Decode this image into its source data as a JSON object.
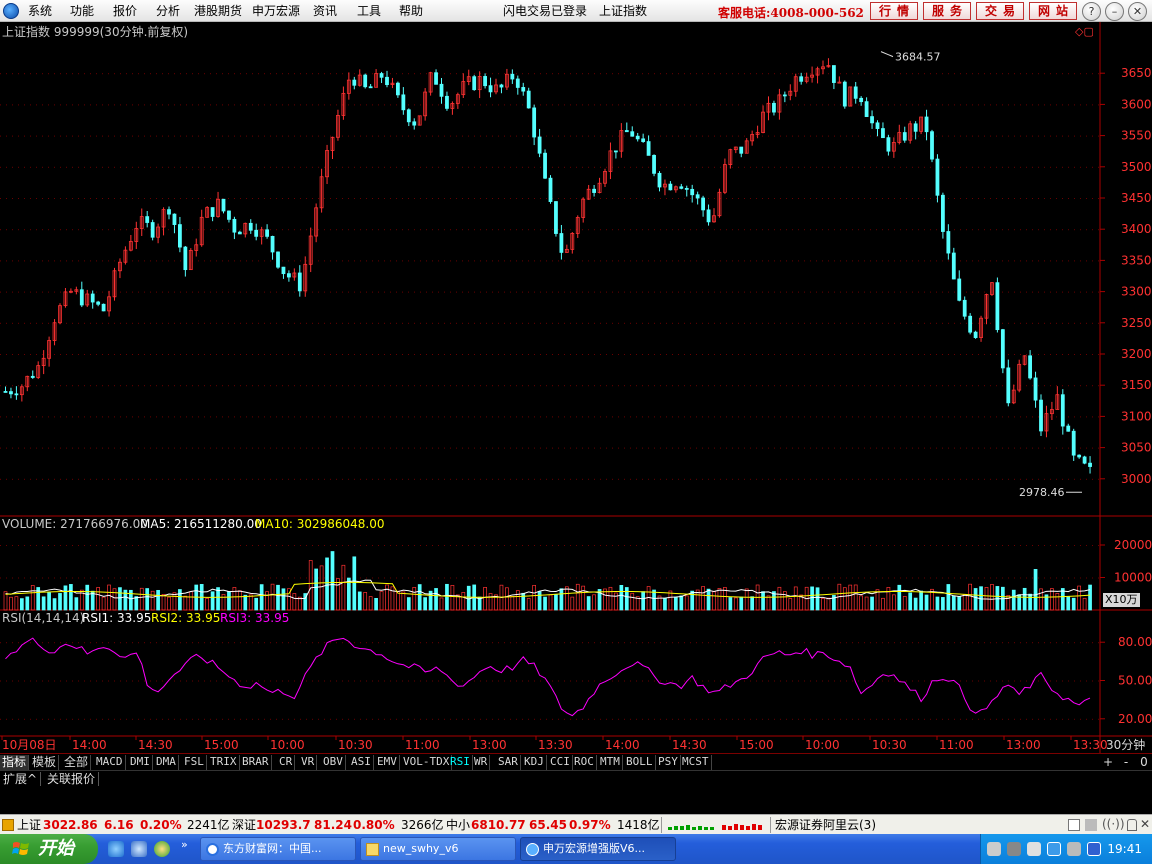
{
  "menubar": {
    "items": [
      "系统",
      "功能",
      "报价",
      "分析",
      "港股期货",
      "申万宏源",
      "资讯",
      "工具",
      "帮助"
    ],
    "login_status": "闪电交易已登录",
    "current_index": "上证指数",
    "hotline": "客服电话:4008-000-562",
    "buttons": [
      "行情",
      "服务",
      "交易",
      "网站"
    ]
  },
  "chart_header": {
    "title": "上证指数 999999(30分钟.前复权)",
    "volume_label": "VOLUME: 271766976.00",
    "ma5_label": "MA5: 216511280.00",
    "ma10_label": "MA10: 302986048.00",
    "rsi_label": "RSI(14,14,14)",
    "rsi1_label": "RSI1: 33.95",
    "rsi2_label": "RSI2: 33.95",
    "rsi3_label": "RSI3: 33.95",
    "high_marker": "3684.57",
    "low_marker": "2978.46",
    "volume_unit": "X10万",
    "period_label": "30分钟"
  },
  "chart_data": [
    {
      "type": "candlestick",
      "title": "上证指数 999999(30分钟.前复权)",
      "y_ticks": [
        3000,
        3050,
        3100,
        3150,
        3200,
        3250,
        3300,
        3350,
        3400,
        3450,
        3500,
        3550,
        3600,
        3650
      ],
      "ylim": [
        2950,
        3700
      ],
      "annotations": [
        {
          "label": "3684.57",
          "value": 3684.57
        },
        {
          "label": "2978.46",
          "value": 2978.46
        }
      ],
      "x_tick_labels": [
        "10月08日",
        "14:00",
        "14:30",
        "15:00",
        "10:00",
        "10:30",
        "11:00",
        "13:00",
        "13:30",
        "14:00",
        "14:30",
        "15:00",
        "10:00",
        "10:30",
        "11:00",
        "13:00",
        "13:30"
      ],
      "approx_close_path": [
        3140,
        3150,
        3180,
        3260,
        3300,
        3285,
        3270,
        3350,
        3410,
        3400,
        3440,
        3330,
        3420,
        3440,
        3400,
        3410,
        3380,
        3330,
        3310,
        3450,
        3560,
        3650,
        3620,
        3650,
        3600,
        3570,
        3650,
        3600,
        3630,
        3640,
        3620,
        3650,
        3580,
        3450,
        3350,
        3440,
        3480,
        3530,
        3560,
        3520,
        3470,
        3480,
        3450,
        3410,
        3520,
        3530,
        3580,
        3600,
        3640,
        3660,
        3670,
        3610,
        3620,
        3550,
        3530,
        3560,
        3570,
        3400,
        3280,
        3230,
        3330,
        3110,
        3200,
        3080,
        3130,
        3030,
        3010
      ]
    },
    {
      "type": "bar",
      "title": "VOLUME",
      "series": [
        {
          "name": "VOLUME"
        },
        {
          "name": "MA5"
        },
        {
          "name": "MA10"
        }
      ],
      "y_ticks": [
        10000,
        20000
      ],
      "unit": "X10万"
    },
    {
      "type": "line",
      "title": "RSI(14,14,14)",
      "y_ticks": [
        20.0,
        50.0,
        80.0
      ],
      "series": [
        {
          "name": "RSI1",
          "last": 33.95
        },
        {
          "name": "RSI2",
          "last": 33.95
        },
        {
          "name": "RSI3",
          "last": 33.95
        }
      ],
      "approx_rsi_path": [
        70,
        74,
        82,
        78,
        72,
        80,
        76,
        70,
        78,
        74,
        68,
        72,
        40,
        45,
        55,
        62,
        70,
        64,
        58,
        50,
        45,
        48,
        40,
        42,
        38,
        55,
        70,
        80,
        84,
        78,
        74,
        72,
        66,
        62,
        60,
        56,
        60,
        50,
        46,
        54,
        62,
        58,
        60,
        66,
        60,
        48,
        30,
        22,
        30,
        44,
        52,
        58,
        64,
        60,
        52,
        48,
        46,
        52,
        44,
        40,
        46,
        50,
        58,
        68,
        72,
        70,
        74,
        70,
        72,
        66,
        62,
        40,
        48,
        58,
        52,
        44,
        36,
        50,
        54,
        46,
        30,
        24,
        34,
        48,
        38,
        46,
        54,
        42,
        36,
        30,
        33.95
      ]
    }
  ],
  "x_axis": {
    "labels": [
      "10月08日",
      "14:00",
      "14:30",
      "15:00",
      "10:00",
      "10:30",
      "11:00",
      "13:00",
      "13:30",
      "14:00",
      "14:30",
      "15:00",
      "10:00",
      "10:30",
      "11:00",
      "13:00",
      "13:30"
    ]
  },
  "mode_tabs": [
    "指标",
    "模板",
    "全部"
  ],
  "indicator_tabs": [
    "MACD",
    "DMI",
    "DMA",
    "FSL",
    "TRIX",
    "BRAR",
    "CR",
    "VR",
    "OBV",
    "ASI",
    "EMV",
    "VOL-TDX",
    "RSI",
    "WR",
    "SAR",
    "KDJ",
    "CCI",
    "ROC",
    "MTM",
    "BOLL",
    "PSY",
    "MCST"
  ],
  "active_indicator": "RSI",
  "pane_buttons": [
    "+",
    "-",
    "0"
  ],
  "sub_tabs": [
    "扩展^",
    "关联报价"
  ],
  "statusbar": {
    "sh_name": "上证",
    "sh_value": "3022.86",
    "sh_change": "6.16",
    "sh_pct": "0.20%",
    "sh_amount": "2241亿",
    "sz_name": "深证",
    "sz_value": "10293.7",
    "sz_change": "81.24",
    "sz_pct": "0.80%",
    "sz_amount": "3266亿",
    "zx_name": "中小",
    "zx_value": "6810.77",
    "zx_change": "65.45",
    "zx_pct": "0.97%",
    "zx_amount": "1418亿",
    "server": "宏源证券阿里云(3)"
  },
  "taskbar": {
    "start": "开始",
    "tasks": [
      "东方财富网：中国...",
      "new_swhy_v6",
      "申万宏源增强版V6..."
    ],
    "clock": "19:41"
  },
  "colors": {
    "up": "#ff3232",
    "down": "#54ffff",
    "axis": "#aa0000",
    "rsi": "#ff00ff",
    "ma5": "#ffffff",
    "ma10": "#ffff00"
  }
}
